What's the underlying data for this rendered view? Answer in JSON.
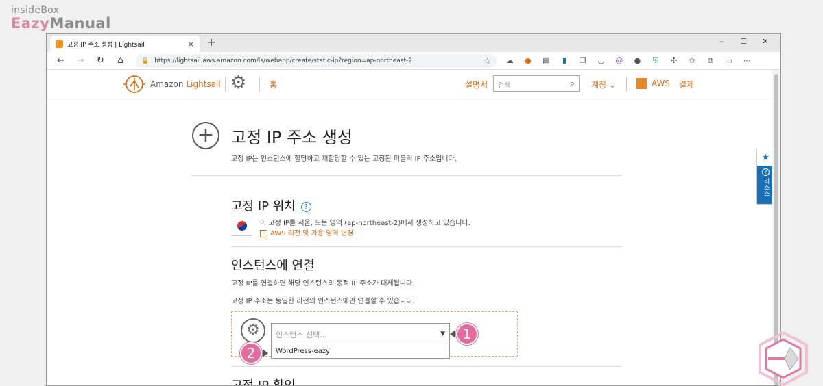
{
  "watermark": {
    "line1": "insideBox",
    "line2a": "Eazy",
    "line2b": "Manual"
  },
  "browser": {
    "tab_title": "고정 IP 주소 생성 | Lightsail",
    "tab_close": "×",
    "new_tab": "+",
    "url": "https://lightsail.aws.amazon.com/ls/webapp/create/static-ip?region=ap-northeast-2",
    "window_buttons": [
      "–",
      "☐",
      "✕"
    ]
  },
  "header": {
    "brand_prefix": "Amazon",
    "brand_name": "Lightsail",
    "home": "홈",
    "docs": "설명서",
    "search_placeholder": "검색",
    "account": "계정 ⌄",
    "aws": "AWS",
    "billing": "결제"
  },
  "page": {
    "title": "고정 IP 주소 생성",
    "subtitle": "고정 IP는 인스턴스에 할당하고 재할당할 수 있는 고정된 퍼블릭 IP 주소입니다.",
    "location": {
      "heading": "고정 IP 위치",
      "help": "?",
      "description": "이 고정 IP를 서울, 모든 영역 (ap-northeast-2)에서 생성하고 있습니다.",
      "change_link": "AWS 리전 및 가용 영역 변경"
    },
    "attach": {
      "heading": "인스턴스에 연결",
      "line1": "고정 IP를 연결하면 해당 인스턴스의 동적 IP 주소가 대체됩니다.",
      "line2": "고정 IP 주소는 동일한 리전의 인스턴스에만 연결할 수 있습니다.",
      "select_placeholder": "인스턴스 선택...",
      "option": "WordPress-eazy"
    },
    "confirm_heading": "고정 IP 확인"
  },
  "badges": {
    "one": "1",
    "two": "2"
  },
  "side_panel": {
    "help_label": "리소스",
    "help_icon": "?"
  },
  "colors": {
    "accent": "#dd6b10",
    "badge": "#e36b9d",
    "help_blue": "#1a6fb5"
  }
}
